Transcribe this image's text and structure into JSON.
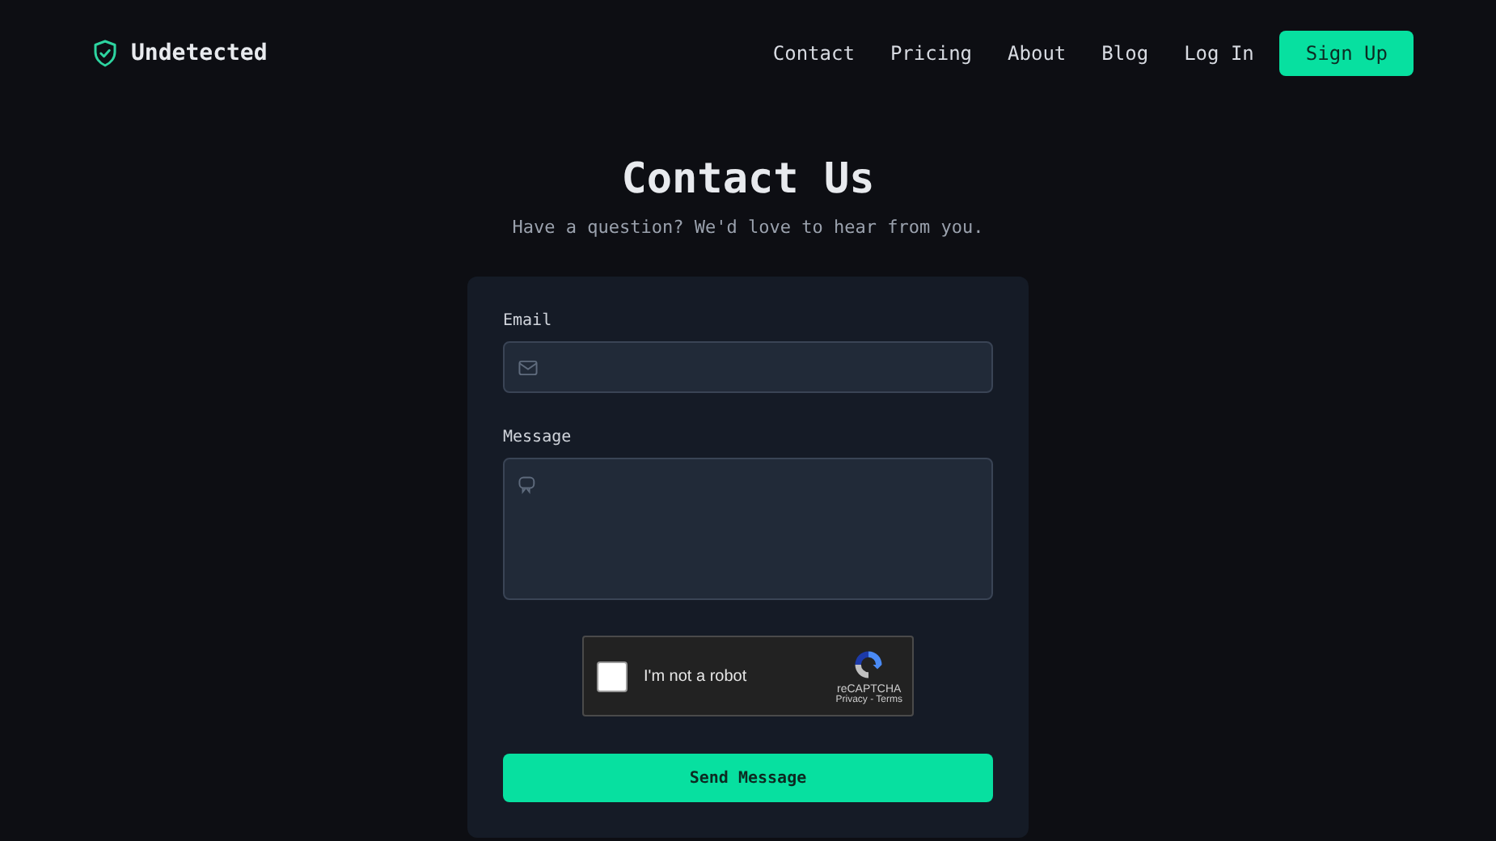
{
  "brand": {
    "name": "Undetected"
  },
  "nav": {
    "links": [
      "Contact",
      "Pricing",
      "About",
      "Blog",
      "Log In"
    ],
    "signup": "Sign Up"
  },
  "hero": {
    "title": "Contact Us",
    "subtitle": "Have a question? We'd love to hear from you."
  },
  "form": {
    "fields": [
      {
        "kind": "input",
        "label": "Email"
      },
      {
        "kind": "textarea",
        "label": "Message"
      }
    ],
    "captcha": {
      "label": "I'm not a robot",
      "checked": false,
      "brand": "reCAPTCHA",
      "links": "Privacy - Terms"
    },
    "submit": "Send Message"
  }
}
